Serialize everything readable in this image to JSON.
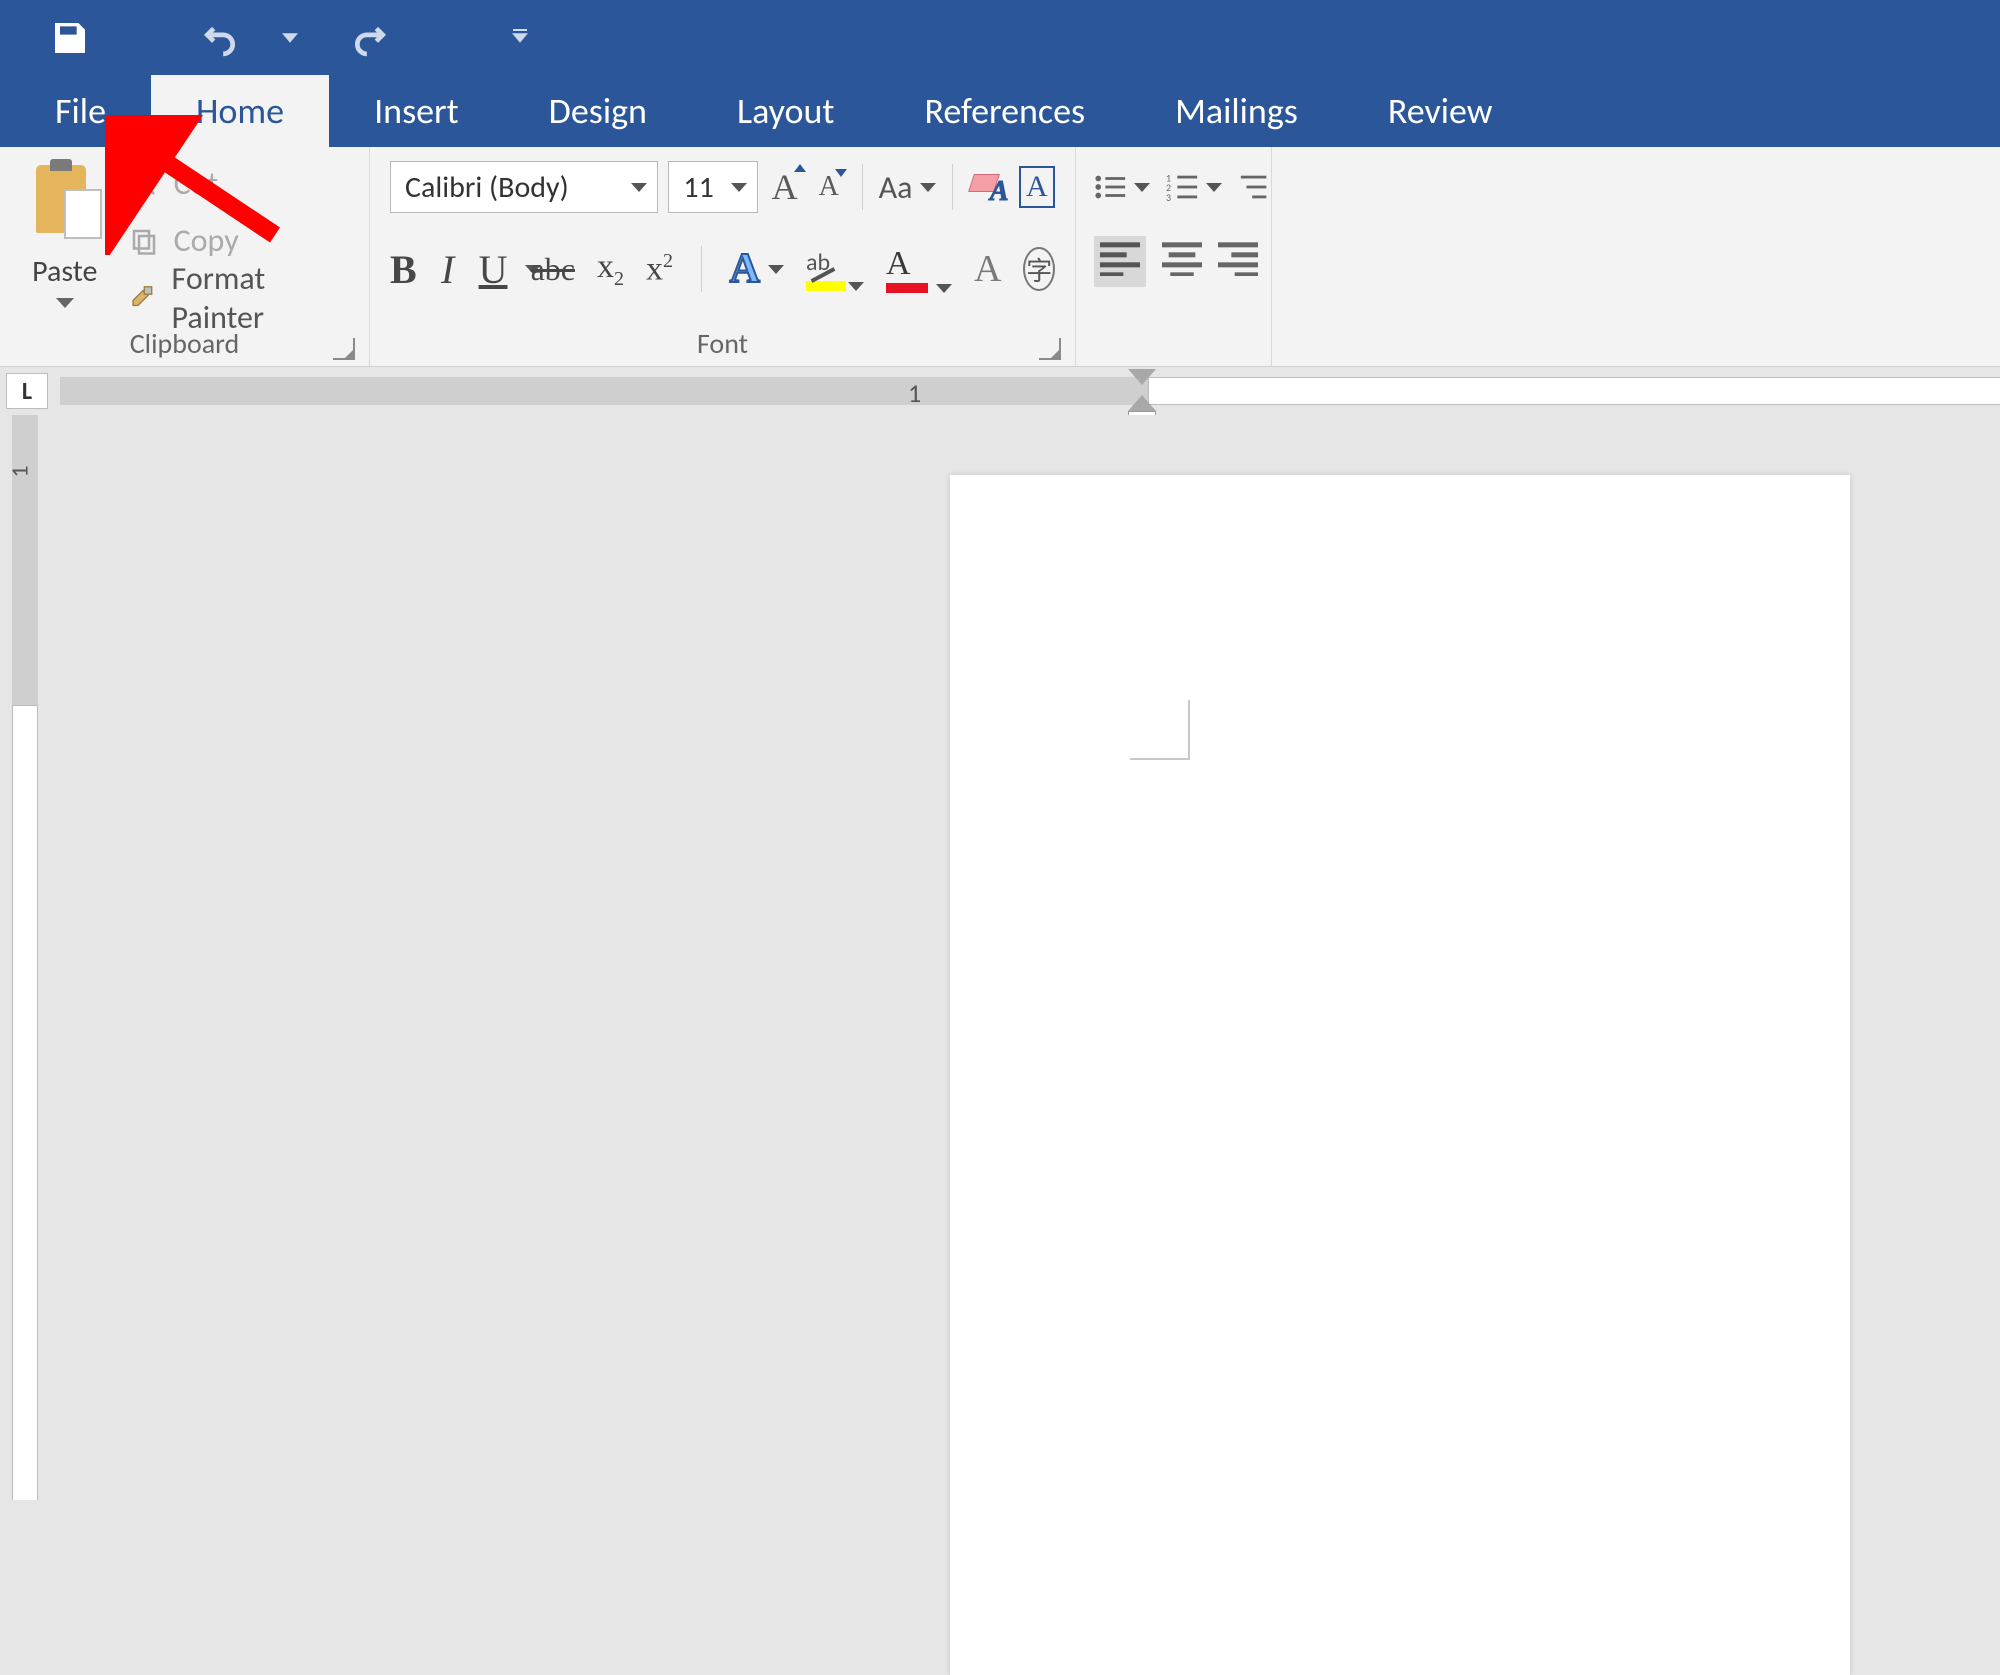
{
  "quick_access": {
    "save": "Save",
    "undo": "Undo",
    "redo": "Redo"
  },
  "tabs": {
    "file": "File",
    "home": "Home",
    "insert": "Insert",
    "design": "Design",
    "layout": "Layout",
    "references": "References",
    "mailings": "Mailings",
    "review": "Review"
  },
  "clipboard": {
    "group_label": "Clipboard",
    "paste": "Paste",
    "cut": "Cut",
    "copy": "Copy",
    "format_painter": "Format Painter"
  },
  "font": {
    "group_label": "Font",
    "name": "Calibri (Body)",
    "size": "11",
    "change_case": "Aa",
    "bold": "B",
    "italic": "I",
    "underline": "U",
    "strike": "abc",
    "sub_x": "x",
    "sub_2": "2",
    "sup_x": "x",
    "sup_2": "2",
    "effects_A": "A",
    "highlight_ab": "ab",
    "color_A": "A",
    "shade_A": "A",
    "circled": "字",
    "border_A": "A",
    "clear_A": "A"
  },
  "ruler": {
    "tabwell": "L",
    "h_num": "1",
    "v_num": "1"
  },
  "colors": {
    "brand": "#2b579a",
    "highlight": "#ffff00",
    "font_color": "#e81123",
    "annotation": "#ff0000"
  }
}
